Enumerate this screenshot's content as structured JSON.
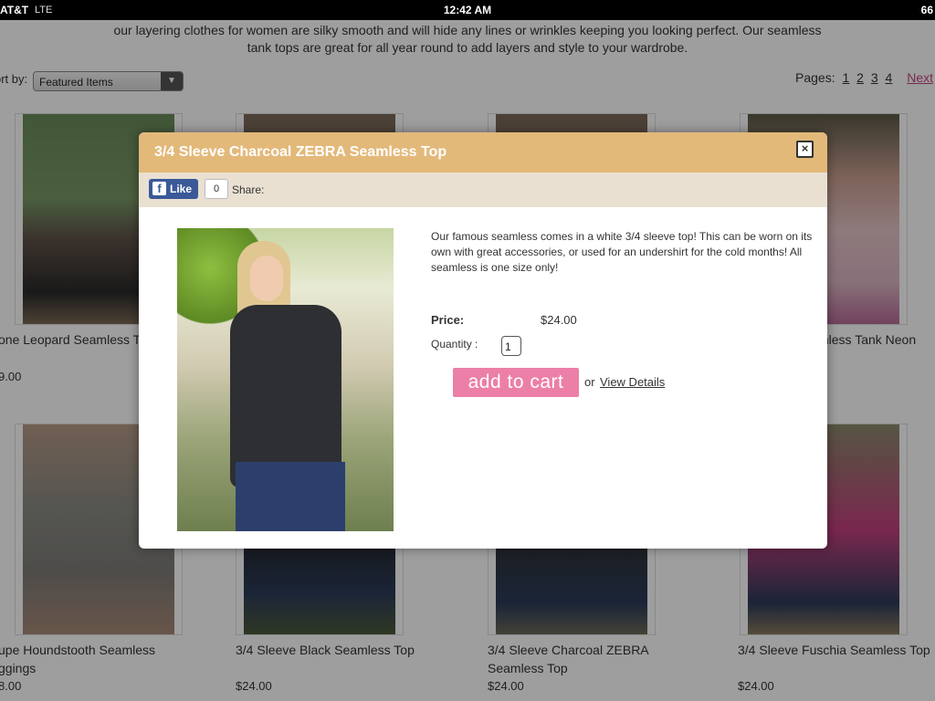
{
  "status_bar": {
    "carrier": "AT&T",
    "network": "LTE",
    "time": "12:42 AM",
    "battery": "66"
  },
  "page": {
    "intro_line1": "our layering clothes for women are silky smooth and will hide any lines or wrinkles keeping you looking perfect. Our seamless",
    "intro_line2": "tank tops are great for all year round to add layers and style to your wardrobe.",
    "sort_label": "ort by:",
    "sort_value": "Featured Items",
    "pages_label": "Pages:",
    "page_links": [
      "1",
      "2",
      "3",
      "4"
    ],
    "next_label": "Next"
  },
  "products": [
    {
      "name": "one Leopard Seamless Ta",
      "price": "9.00"
    },
    {
      "name": "mless Tank Neon",
      "price": ""
    },
    {
      "name_line1": "upe Houndstooth Seamless",
      "name_line2": "ggings",
      "price": "8.00"
    },
    {
      "name": "3/4 Sleeve Black Seamless Top",
      "price": "$24.00"
    },
    {
      "name_line1": "3/4 Sleeve Charcoal ZEBRA",
      "name_line2": "Seamless Top",
      "price": "$24.00"
    },
    {
      "name": "3/4 Sleeve Fuschia Seamless Top",
      "price": "$24.00"
    }
  ],
  "modal": {
    "title": "3/4 Sleeve Charcoal ZEBRA Seamless Top",
    "close_icon": "×",
    "fb_like_label": "Like",
    "fb_icon": "f",
    "fb_count": "0",
    "share_label": "Share:",
    "description": "Our famous seamless comes in a white 3/4 sleeve top!  This can be worn on its own with great accessories, or used for an undershirt for the cold months! All seamless is one size only!",
    "price_label": "Price:",
    "price_value": "$24.00",
    "quantity_label": "Quantity :",
    "quantity_value": "1",
    "add_to_cart_label": "add to cart",
    "or_label": "or",
    "view_details_label": "View Details"
  },
  "colors": {
    "modal_header": "#e3b97a",
    "add_to_cart": "#ec7fa7",
    "next_link": "#c1487f",
    "facebook": "#3b5998"
  }
}
